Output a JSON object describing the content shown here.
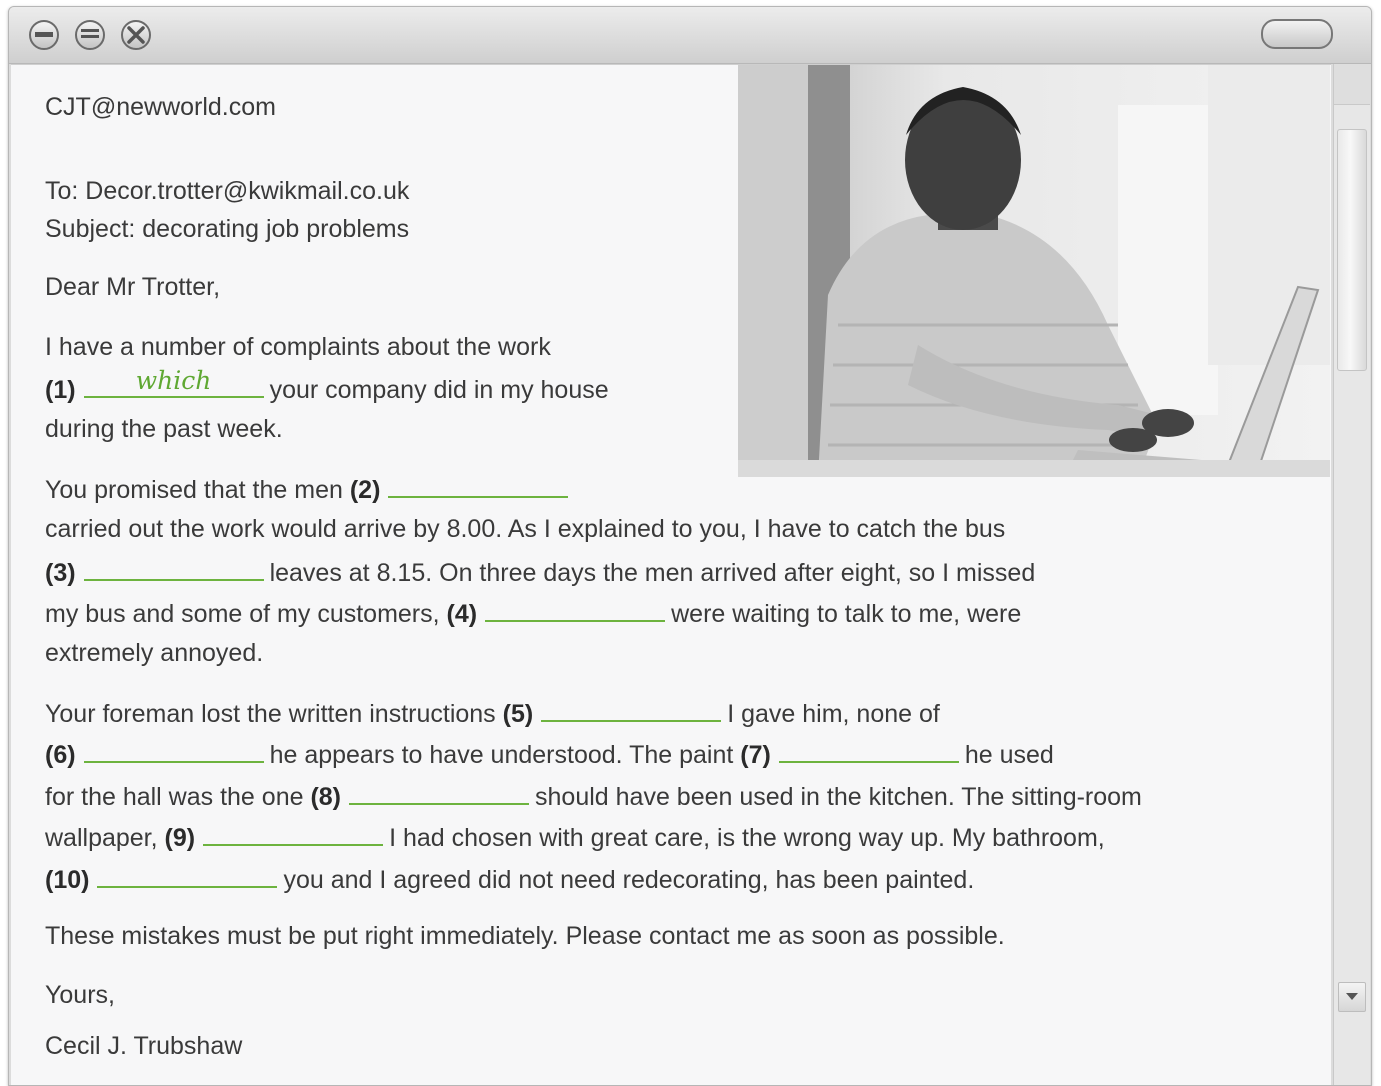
{
  "email": {
    "from": "CJT@newworld.com",
    "to": "To: Decor.trotter@kwikmail.co.uk",
    "subject": "Subject: decorating job problems",
    "greeting": "Dear Mr Trotter,",
    "p1": {
      "l1": "I have a number of complaints about the work",
      "n1": "(1)",
      "a1": "which",
      "l2": "your company did in my house",
      "l3": "during the past week."
    },
    "p2": {
      "s1": "You promised that the men",
      "n2": "(2)",
      "l2": "carried out the work would arrive by 8.00. As I explained to you, I have to catch the bus",
      "n3": "(3)",
      "l3": "leaves at 8.15. On three days the men arrived after eight, so I missed",
      "l4a": "my bus and some of my customers,",
      "n4": "(4)",
      "l4b": "were waiting to talk to me, were",
      "l5": "extremely annoyed."
    },
    "p3": {
      "l1a": "Your foreman lost the written instructions",
      "n5": "(5)",
      "l1b": "I gave him, none of",
      "n6": "(6)",
      "l2a": "he appears to have understood. The paint",
      "n7": "(7)",
      "l2b": "he used",
      "l3a": "for the hall was the one",
      "n8": "(8)",
      "l3b": "should have been used in the kitchen. The sitting-room",
      "l4a": "wallpaper,",
      "n9": "(9)",
      "l4b": "I had chosen with great care, is the wrong way up. My bathroom,",
      "n10": "(10)",
      "l5": "you and I agreed did not need redecorating, has been painted."
    },
    "p4": "These mistakes must be put right immediately. Please contact me as soon as possible.",
    "closing": "Yours,",
    "signature": "Cecil J. Trubshaw"
  },
  "icons": {
    "minimize": "minimize-icon",
    "maximize": "maximize-icon",
    "close": "close-icon",
    "scroll_down": "chevron-down-icon"
  },
  "colors": {
    "blank_line": "#6db33f",
    "answer": "#5fa832",
    "text": "#3a3a3a"
  }
}
